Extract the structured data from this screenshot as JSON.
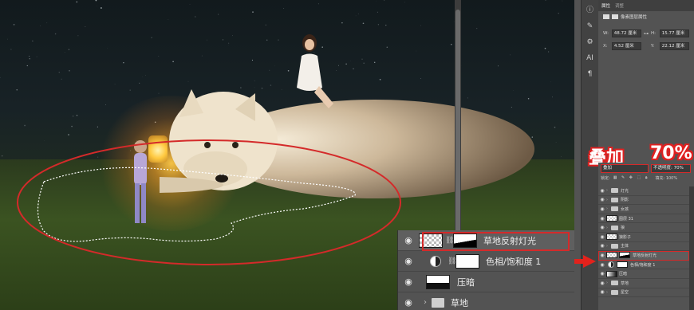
{
  "props_panel": {
    "tab_properties": "属性",
    "tab_adjust": "调整",
    "title": "像素图层属性",
    "w_label": "W:",
    "w_value": "48.72 厘米",
    "h_label": "H:",
    "h_value": "15.77 厘米",
    "x_label": "X:",
    "x_value": "4.52 厘米",
    "y_label": "Y:",
    "y_value": "22.12 厘米"
  },
  "annotation": {
    "blend_text": "叠加",
    "opacity_text": "70%"
  },
  "layers_panel": {
    "tab_layers": "图层",
    "blend_mode": "叠加",
    "opacity": "不透明度: 70%",
    "lock_label": "锁定:",
    "fill": "填充: 100%",
    "small_rows": [
      {
        "label": "灯光",
        "kind": "folder"
      },
      {
        "label": "阴影",
        "kind": "folder"
      },
      {
        "label": "女孩",
        "kind": "folder"
      },
      {
        "label": "图层 31",
        "kind": "check"
      },
      {
        "label": "狼",
        "kind": "folder"
      },
      {
        "label": "狼影子",
        "kind": "check"
      },
      {
        "label": "主体",
        "kind": "folder"
      },
      {
        "label": "草地反射灯光",
        "kind": "check"
      },
      {
        "label": "色相/饱和度 1",
        "kind": "adj"
      },
      {
        "label": "压暗",
        "kind": "dark"
      },
      {
        "label": "草地",
        "kind": "folder"
      },
      {
        "label": "星空",
        "kind": "folder"
      }
    ]
  },
  "zoom_layers": [
    {
      "label": "草地反射灯光",
      "kind": "check"
    },
    {
      "label": "色相/饱和度 1",
      "kind": "adj"
    },
    {
      "label": "压暗",
      "kind": "dark"
    },
    {
      "label": "草地",
      "kind": "folder"
    }
  ],
  "icons": {
    "eye": "eye-icon",
    "link": "link-icon",
    "folder": "folder-icon"
  },
  "colors": {
    "highlight": "#d42a2a",
    "panel": "#535353"
  }
}
